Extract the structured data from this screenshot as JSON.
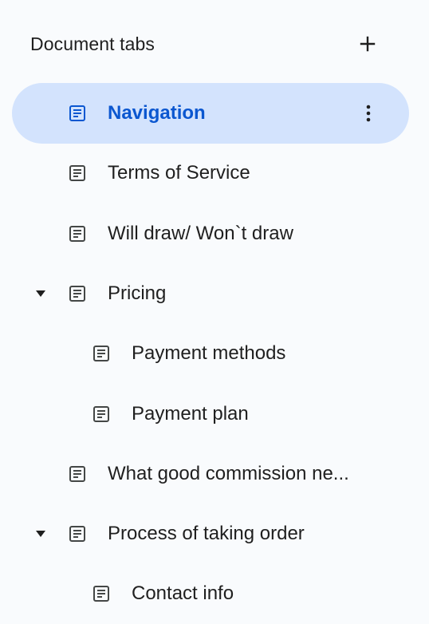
{
  "header": {
    "title": "Document tabs",
    "add_icon": "plus-icon"
  },
  "tabs": [
    {
      "label": "Navigation",
      "level": 0,
      "selected": true,
      "expandable": false,
      "icon": "document-icon",
      "menu_icon": "more-vert-icon"
    },
    {
      "label": "Terms of Service",
      "level": 0,
      "selected": false,
      "expandable": false,
      "icon": "document-icon"
    },
    {
      "label": "Will draw/ Won`t draw",
      "level": 0,
      "selected": false,
      "expandable": false,
      "icon": "document-icon"
    },
    {
      "label": "Pricing",
      "level": 0,
      "selected": false,
      "expandable": true,
      "expanded": true,
      "icon": "document-icon"
    },
    {
      "label": "Payment methods",
      "level": 1,
      "selected": false,
      "expandable": false,
      "icon": "document-icon"
    },
    {
      "label": "Payment plan",
      "level": 1,
      "selected": false,
      "expandable": false,
      "icon": "document-icon"
    },
    {
      "label": "What good commission ne...",
      "level": 0,
      "selected": false,
      "expandable": false,
      "icon": "document-icon"
    },
    {
      "label": "Process of taking order",
      "level": 0,
      "selected": false,
      "expandable": true,
      "expanded": true,
      "icon": "document-icon"
    },
    {
      "label": "Contact info",
      "level": 1,
      "selected": false,
      "expandable": false,
      "icon": "document-icon"
    }
  ],
  "colors": {
    "background": "#f9fbfd",
    "selected_bg": "#d3e3fd",
    "selected_text": "#0b57d0",
    "text": "#1f1f1f",
    "icon": "#444746"
  }
}
